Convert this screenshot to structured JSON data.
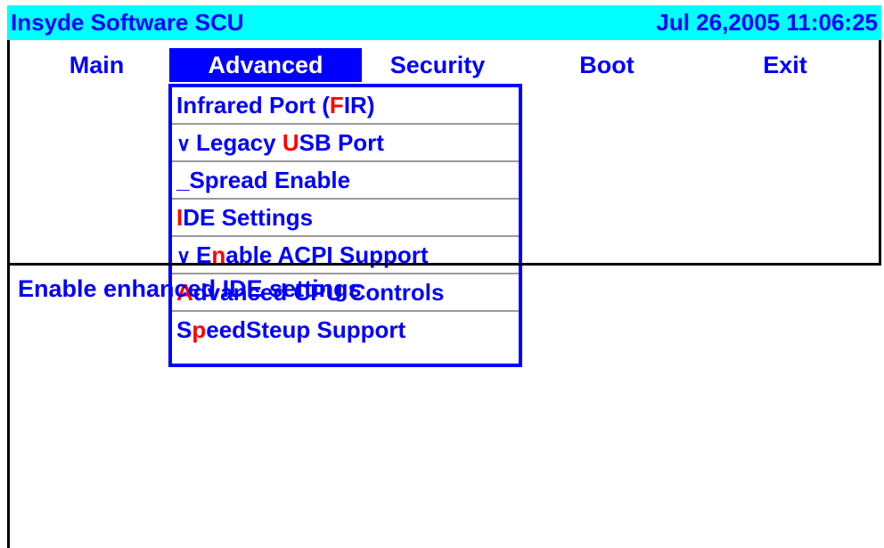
{
  "header": {
    "title": "Insyde Software SCU",
    "datetime": "Jul 26,2005 11:06:25"
  },
  "menu": {
    "tabs": [
      {
        "label": "Main"
      },
      {
        "label": "Advanced"
      },
      {
        "label": "Security"
      },
      {
        "label": "Boot"
      },
      {
        "label": "Exit"
      }
    ],
    "active": "Advanced"
  },
  "dropdown": {
    "items": [
      {
        "check": "",
        "pre": "Infrared Port (",
        "hot": "F",
        "post": "IR)"
      },
      {
        "check": "∨",
        "pre": "Legacy ",
        "hot": "U",
        "post": "SB Port"
      },
      {
        "check": "",
        "pre": "_Spread Enable",
        "hot": "",
        "post": ""
      },
      {
        "check": "",
        "pre": "",
        "hot": "I",
        "post": "DE Settings"
      },
      {
        "check": "∨",
        "pre": "E",
        "hot": "n",
        "post": "able ACPI Support"
      },
      {
        "check": "",
        "pre": "",
        "hot": "A",
        "post": "dvanced CPU Controls"
      },
      {
        "check": "",
        "pre": "S",
        "hot": "p",
        "post": "eedSteup Support"
      }
    ]
  },
  "help": {
    "text": "Enable enhanced IDE settings"
  },
  "colors": {
    "title_bg": "#00ffff",
    "text": "#0000ff",
    "hotkey": "#ff0000",
    "active_tab_bg": "#0000ff",
    "active_tab_text": "#ffffff"
  }
}
